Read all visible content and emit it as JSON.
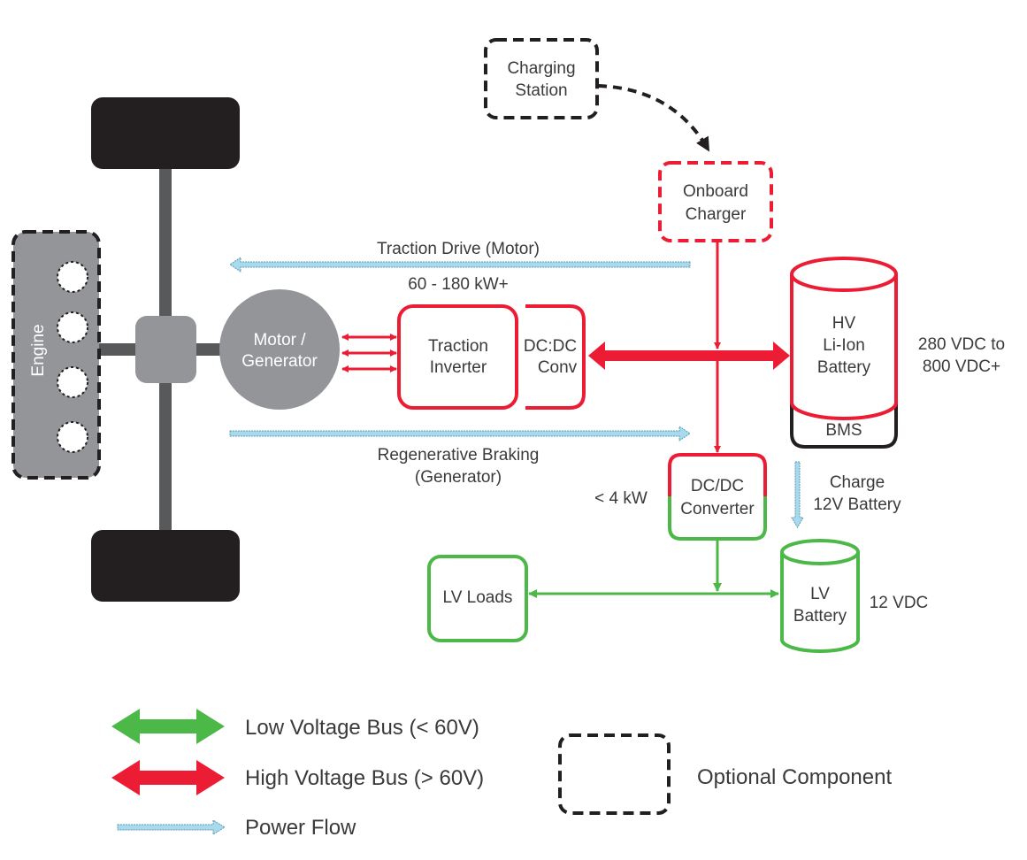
{
  "colors": {
    "high_voltage": "#ed1c35",
    "low_voltage": "#4cb848",
    "power_flow": "#a9d9ec",
    "component_gray": "#939598",
    "shaft": "#58595b",
    "wheel": "#231f20"
  },
  "components": {
    "engine": "Engine",
    "motor": [
      "Motor /",
      "Generator"
    ],
    "traction_inverter": [
      "Traction",
      "Inverter"
    ],
    "dcdc_conv": [
      "DC:DC",
      "Conv"
    ],
    "charging_station": [
      "Charging",
      "Station"
    ],
    "onboard_charger": [
      "Onboard",
      "Charger"
    ],
    "hv_battery": [
      "HV",
      "Li-Ion",
      "Battery"
    ],
    "bms": "BMS",
    "dcdc_converter": [
      "DC/DC",
      "Converter"
    ],
    "lv_loads": "LV Loads",
    "lv_battery": [
      "LV",
      "Battery"
    ]
  },
  "annotations": {
    "traction_drive": "Traction Drive (Motor)",
    "traction_power": "60 - 180 kW+",
    "regen": [
      "Regenerative Braking",
      "(Generator)"
    ],
    "hv_voltage": [
      "280 VDC to",
      "800 VDC+"
    ],
    "dcdc_power": "< 4 kW",
    "charge_12v": [
      "Charge",
      "12V Battery"
    ],
    "lv_voltage": "12 VDC"
  },
  "legend": {
    "low_voltage": "Low Voltage Bus (< 60V)",
    "high_voltage": "High Voltage Bus (> 60V)",
    "power_flow": "Power Flow",
    "optional": "Optional Component"
  }
}
